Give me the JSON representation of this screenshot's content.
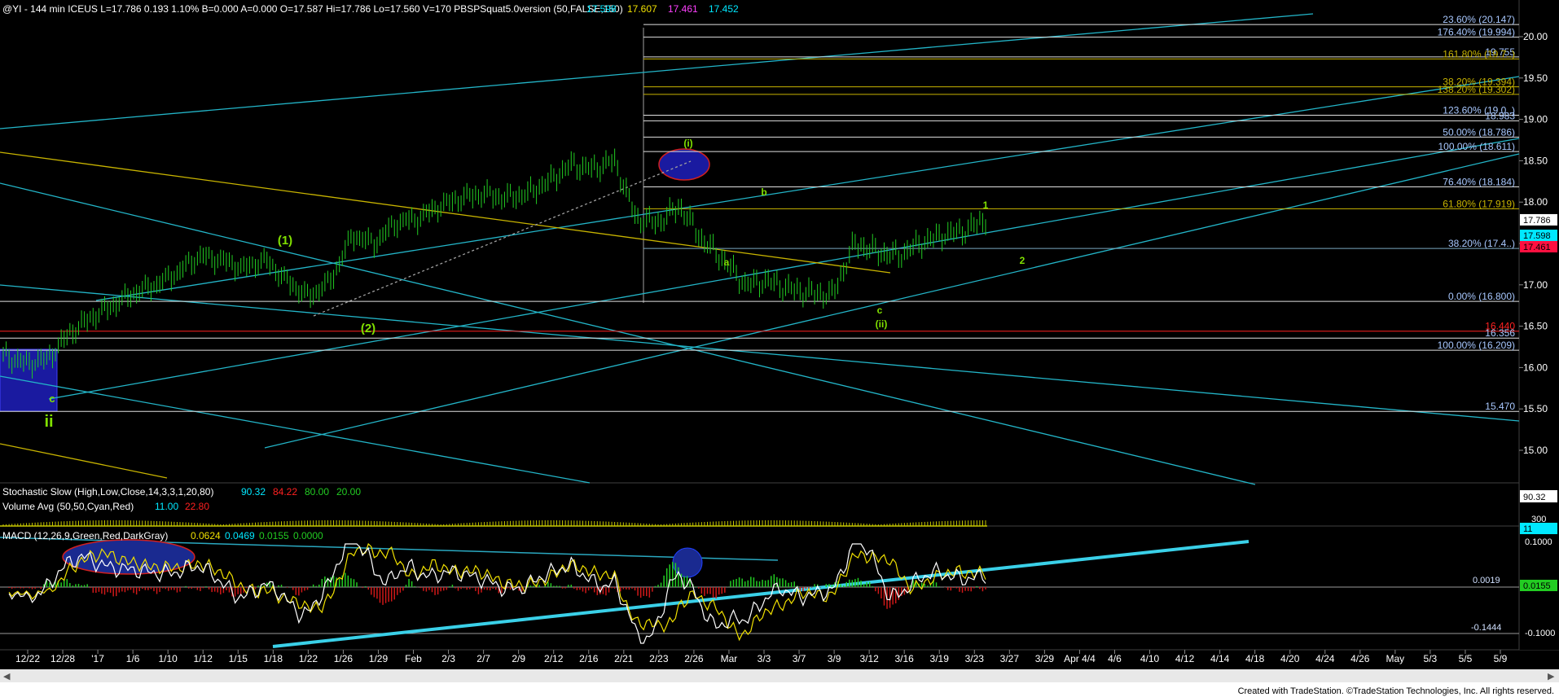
{
  "header": {
    "symbol_line": "@YI - 144 min  ICEUS  L=17.786  0.193  1.10%  B=0.000  A=0.000  O=17.587  Hi=17.786  Lo=17.560  V=170  PBSPSquat5.0version (50,FALSE,150)",
    "v1": "17.598",
    "v2": "17.607",
    "v3": "17.461",
    "v4": "17.452"
  },
  "indicators": {
    "stoch_label": "Stochastic Slow (High,Low,Close,14,3,3,1,20,80)",
    "stoch_v1": "90.32",
    "stoch_v2": "84.22",
    "stoch_v3": "80.00",
    "stoch_v4": "20.00",
    "vol_label": "Volume Avg (50,50,Cyan,Red)",
    "vol_v1": "11.00",
    "vol_v2": "22.80",
    "macd_label": "MACD (12,26,9,Green,Red,DarkGray)",
    "macd_v1": "0.0624",
    "macd_v2": "0.0469",
    "macd_v3": "0.0155",
    "macd_v4": "0.0000"
  },
  "footer": "Created with TradeStation. ©TradeStation Technologies, Inc. All rights reserved.",
  "colors": {
    "cyan": "#23b5c8",
    "yellow": "#c8b400",
    "white": "#d8d8d8",
    "red": "#d01818",
    "green": "#22cc22",
    "wave": "#80e000"
  },
  "chart_data": {
    "type": "line",
    "price_axis": {
      "ticks": [
        20.0,
        19.5,
        19.0,
        18.5,
        18.0,
        17.5,
        17.0,
        16.5,
        16.0,
        15.5,
        15.0
      ],
      "last_price_labels": [
        {
          "text": "17.786",
          "value": 17.786,
          "color": "#ffffff"
        },
        {
          "text": "17.598",
          "value": 17.598,
          "color": "#00e8ff"
        },
        {
          "text": "17.461",
          "value": 17.461,
          "color": "#ff1040"
        }
      ]
    },
    "x_axis": {
      "labels": [
        "12/22",
        "12/28",
        "'17",
        "1/6",
        "1/10",
        "1/12",
        "1/15",
        "1/18",
        "1/22",
        "1/26",
        "1/29",
        "Feb",
        "2/3",
        "2/7",
        "2/9",
        "2/12",
        "2/16",
        "2/21",
        "2/23",
        "2/26",
        "Mar",
        "3/3",
        "3/7",
        "3/9",
        "3/12",
        "3/16",
        "3/19",
        "3/23",
        "3/27",
        "3/29",
        "Apr 4/4",
        "4/6",
        "4/10",
        "4/12",
        "4/14",
        "4/18",
        "4/20",
        "4/24",
        "4/26",
        "May",
        "5/3",
        "5/5",
        "5/9"
      ]
    },
    "fib_levels": [
      {
        "label": "23.60% (20.147)",
        "value": 20.147
      },
      {
        "label": "176.40% (19.994)",
        "value": 19.994
      },
      {
        "label": "19.755",
        "value": 19.755
      },
      {
        "label": "161.80% (19.7..)",
        "value": 19.73
      },
      {
        "label": "38.20% (19.394)",
        "value": 19.394
      },
      {
        "label": "138.20% (19.302)",
        "value": 19.302
      },
      {
        "label": "123.60% (19.0..)",
        "value": 19.05
      },
      {
        "label": "18.983",
        "value": 18.983
      },
      {
        "label": "50.00% (18.786)",
        "value": 18.786
      },
      {
        "label": "100.00% (18.611)",
        "value": 18.611
      },
      {
        "label": "76.40% (18.184)",
        "value": 18.184
      },
      {
        "label": "61.80% (17.919)",
        "value": 17.919
      },
      {
        "label": "38.20% (17.4..)",
        "value": 17.44
      },
      {
        "label": "0.00% (16.800)",
        "value": 16.8
      },
      {
        "label": "16.440",
        "value": 16.44
      },
      {
        "label": "16.356",
        "value": 16.356
      },
      {
        "label": "100.00% (16.209)",
        "value": 16.209
      },
      {
        "label": "15.470",
        "value": 15.47
      }
    ],
    "wave_labels": [
      "(1)",
      "(2)",
      "(i)",
      "(ii)",
      "ii",
      "c",
      "a",
      "b",
      "c",
      "1",
      "2"
    ],
    "price_series": [
      {
        "t": "12/22",
        "close": 16.15
      },
      {
        "t": "12/24",
        "close": 16.05
      },
      {
        "t": "12/28",
        "close": 16.1
      },
      {
        "t": "'17",
        "close": 16.4
      },
      {
        "t": "1/3",
        "close": 16.6
      },
      {
        "t": "1/6",
        "close": 16.75
      },
      {
        "t": "1/10",
        "close": 16.9
      },
      {
        "t": "1/12",
        "close": 17.0
      },
      {
        "t": "1/15",
        "close": 17.15
      },
      {
        "t": "1/18",
        "close": 17.35
      },
      {
        "t": "1/20",
        "close": 17.3
      },
      {
        "t": "1/22",
        "close": 17.2
      },
      {
        "t": "1/24",
        "close": 17.3
      },
      {
        "t": "1/26",
        "close": 17.05
      },
      {
        "t": "1/28",
        "close": 16.85
      },
      {
        "t": "1/29",
        "close": 17.05
      },
      {
        "t": "Feb",
        "close": 17.6
      },
      {
        "t": "2/3",
        "close": 17.5
      },
      {
        "t": "2/7",
        "close": 17.75
      },
      {
        "t": "2/9",
        "close": 17.8
      },
      {
        "t": "2/12",
        "close": 17.95
      },
      {
        "t": "2/14",
        "close": 18.05
      },
      {
        "t": "2/16",
        "close": 18.1
      },
      {
        "t": "2/19",
        "close": 18.05
      },
      {
        "t": "2/21",
        "close": 18.1
      },
      {
        "t": "2/23",
        "close": 18.25
      },
      {
        "t": "2/26",
        "close": 18.45
      },
      {
        "t": "2/28",
        "close": 18.4
      },
      {
        "t": "Mar",
        "close": 18.5
      },
      {
        "t": "3/2",
        "close": 17.8
      },
      {
        "t": "3/3",
        "close": 17.75
      },
      {
        "t": "3/5",
        "close": 17.95
      },
      {
        "t": "3/7",
        "close": 17.55
      },
      {
        "t": "3/8",
        "close": 17.3
      },
      {
        "t": "3/9",
        "close": 17.0
      },
      {
        "t": "3/11",
        "close": 17.05
      },
      {
        "t": "3/12",
        "close": 16.95
      },
      {
        "t": "3/14",
        "close": 16.9
      },
      {
        "t": "3/15",
        "close": 16.88
      },
      {
        "t": "3/16",
        "close": 17.5
      },
      {
        "t": "3/17",
        "close": 17.4
      },
      {
        "t": "3/19",
        "close": 17.35
      },
      {
        "t": "3/21",
        "close": 17.5
      },
      {
        "t": "3/23",
        "close": 17.6
      },
      {
        "t": "3/25",
        "close": 17.65
      },
      {
        "t": "3/26",
        "close": 17.786
      }
    ],
    "macd_axis": {
      "ticks": [
        0.1,
        0.0,
        -0.1
      ],
      "labels": [
        "0.0019",
        "-0.1444"
      ]
    },
    "stoch_axis": {
      "labels": [
        "90.32"
      ]
    },
    "volume_axis": {
      "labels": [
        "300",
        "11"
      ]
    }
  }
}
